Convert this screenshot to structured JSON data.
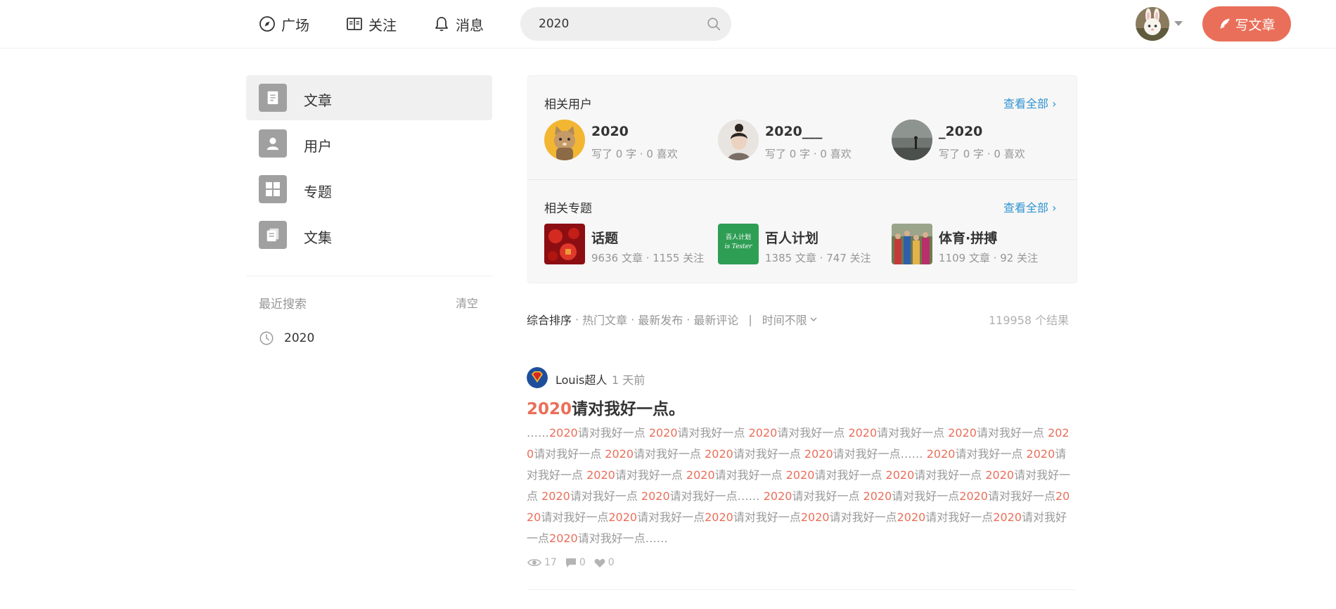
{
  "header": {
    "nav": [
      {
        "label": "广场",
        "icon": "compass-icon"
      },
      {
        "label": "关注",
        "icon": "book-icon"
      },
      {
        "label": "消息",
        "icon": "bell-icon"
      }
    ],
    "search": {
      "value": "2020"
    },
    "write_label": "写文章"
  },
  "sidebar": {
    "items": [
      {
        "label": "文章",
        "icon": "article-icon"
      },
      {
        "label": "用户",
        "icon": "user-icon"
      },
      {
        "label": "专题",
        "icon": "grid-icon"
      },
      {
        "label": "文集",
        "icon": "notebook-icon"
      }
    ],
    "recent_title": "最近搜索",
    "clear_label": "清空",
    "recent": [
      "2020"
    ]
  },
  "related_users": {
    "title": "相关用户",
    "more": "查看全部 ›",
    "users": [
      {
        "name": "2020",
        "meta": "写了 0 字 · 0 喜欢"
      },
      {
        "name": "2020___",
        "meta": "写了 0 字 · 0 喜欢"
      },
      {
        "name": "_2020",
        "meta": "写了 0 字 · 0 喜欢"
      }
    ]
  },
  "related_topics": {
    "title": "相关专题",
    "more": "查看全部 ›",
    "topics": [
      {
        "name": "话题",
        "meta": "9636 文章 · 1155 关注"
      },
      {
        "name": "百人计划",
        "meta": "1385 文章 · 747 关注",
        "logo_text": [
          "百人计划",
          "is Tester"
        ]
      },
      {
        "name": "体育·拼搏",
        "meta": "1109 文章 · 92 关注"
      }
    ]
  },
  "sort": {
    "options": [
      "综合排序",
      "热门文章",
      "最新发布",
      "最新评论"
    ],
    "time_filter": "时间不限",
    "results": "119958 个结果"
  },
  "article": {
    "author": "Louis超人",
    "time": "1 天前",
    "title_highlight": "2020",
    "title_rest": "请对我好一点。",
    "abstract": "……2020请对我好一点 2020请对我好一点 2020请对我好一点 2020请对我好一点 2020请对我好一点 2020请对我好一点 2020请对我好一点 2020请对我好一点 2020请对我好一点…… 2020请对我好一点 2020请对我好一点 2020请对我好一点 2020请对我好一点 2020请对我好一点 2020请对我好一点 2020请对我好一点 2020请对我好一点 2020请对我好一点…… 2020请对我好一点 2020请对我好一点2020请对我好一点2020请对我好一点2020请对我好一点2020请对我好一点2020请对我好一点2020请对我好一点2020请对我好一点2020请对我好一点……",
    "highlight_term": "2020",
    "views": "17",
    "comments": "0",
    "likes": "0"
  },
  "colors": {
    "accent": "#ea6f5a",
    "link": "#3194d0"
  }
}
